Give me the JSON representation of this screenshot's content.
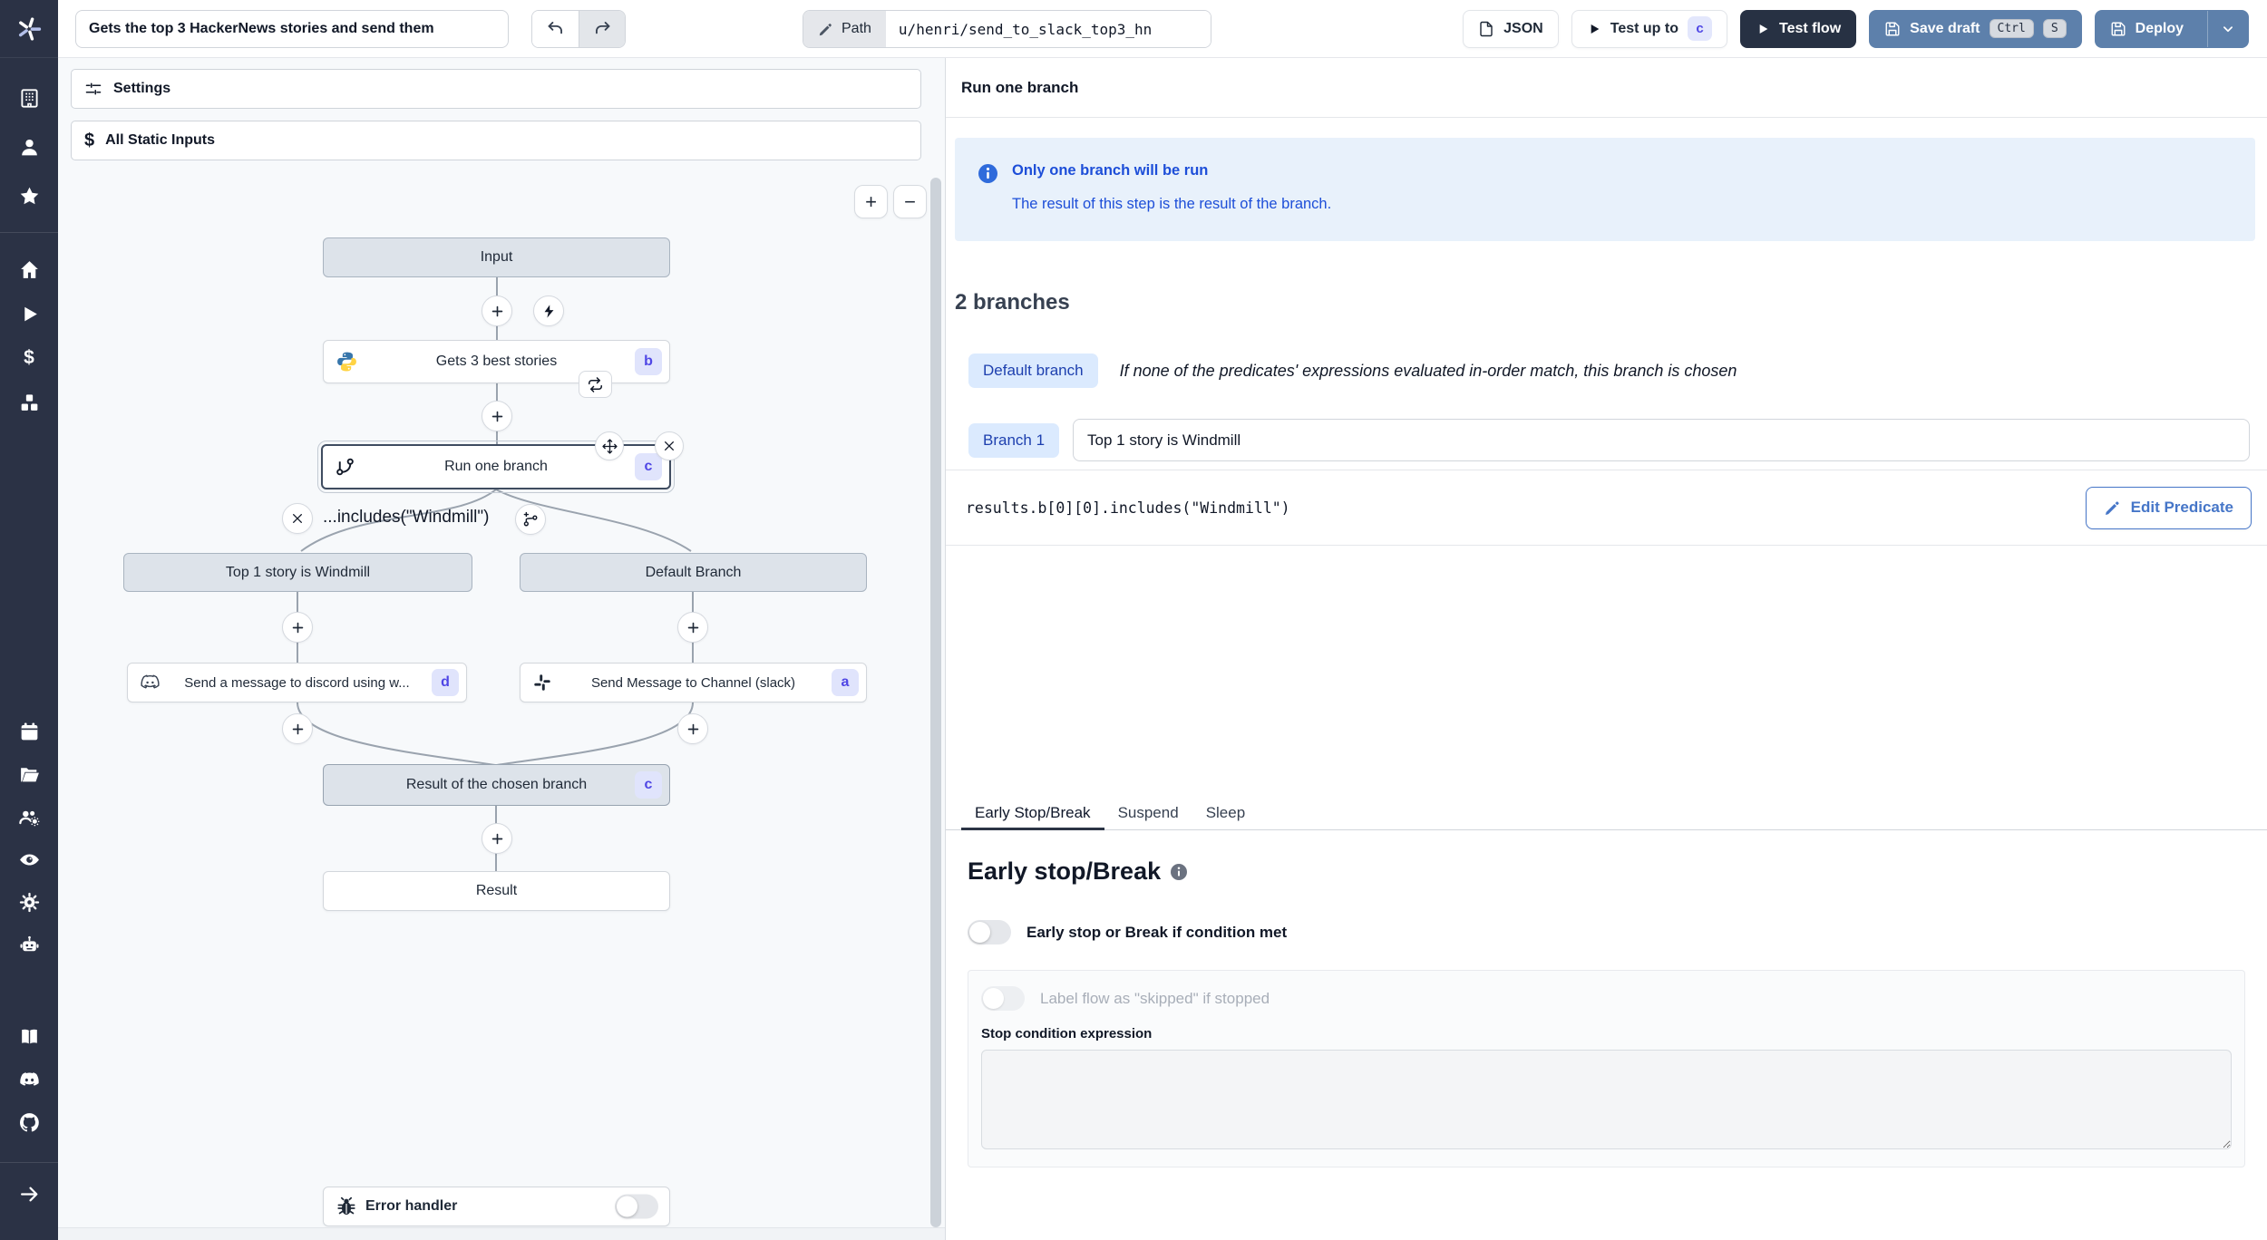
{
  "topbar": {
    "title_value": "Gets the top 3 HackerNews stories and send them",
    "path_label": "Path",
    "path_value": "u/henri/send_to_slack_top3_hn",
    "json_label": "JSON",
    "test_up_to_label": "Test up to",
    "test_up_to_badge": "c",
    "test_flow_label": "Test flow",
    "save_draft_label": "Save draft",
    "kbd": [
      "Ctrl",
      "S"
    ],
    "deploy_label": "Deploy"
  },
  "sidebar": {
    "icons": [
      "workspace",
      "user",
      "favorites",
      "home",
      "runs",
      "variables",
      "resources",
      "schedules",
      "folders",
      "groups",
      "audit-logs",
      "settings",
      "workers",
      "docs",
      "discord",
      "github",
      "expand-sidebar"
    ]
  },
  "flow": {
    "settings_label": "Settings",
    "static_inputs_label": "All Static Inputs",
    "zoom_in": "+",
    "zoom_out": "−",
    "nodes": {
      "input_label": "Input",
      "step_b_label": "Gets 3 best stories",
      "step_b_badge": "b",
      "branch_step_label": "Run one branch",
      "branch_step_badge": "c",
      "predicate_preview": "...includes(\"Windmill\")",
      "branch_left_label": "Top 1 story is Windmill",
      "branch_right_label": "Default Branch",
      "step_d_label": "Send a message to discord using w...",
      "step_d_badge": "d",
      "step_a_label": "Send Message to Channel (slack)",
      "step_a_badge": "a",
      "result_branch_label": "Result of the chosen branch",
      "result_branch_badge": "c",
      "result_label": "Result",
      "error_handler_label": "Error handler"
    }
  },
  "detail": {
    "title": "Run one branch",
    "info_title": "Only one branch will be run",
    "info_body": "The result of this step is the result of the branch.",
    "branches_heading": "2 branches",
    "default_branch_badge": "Default branch",
    "default_branch_desc": "If none of the predicates' expressions evaluated in-order match, this branch is chosen",
    "branch1_badge": "Branch 1",
    "branch1_summary": "Top 1 story is Windmill",
    "branch1_predicate": "results.b[0][0].includes(\"Windmill\")",
    "edit_predicate_label": "Edit Predicate",
    "tabs": [
      "Early Stop/Break",
      "Suspend",
      "Sleep"
    ],
    "early_stop_heading": "Early stop/Break",
    "early_stop_toggle_label": "Early stop or Break if condition met",
    "skip_toggle_label": "Label flow as \"skipped\" if stopped",
    "stop_condition_label": "Stop condition expression",
    "stop_condition_value": ""
  },
  "colors": {
    "rail_bg": "#2b3245",
    "primary_button": "#5d80ab",
    "dark_button": "#273143",
    "step_badge_bg": "#e0e4fc",
    "step_badge_text": "#4f46e5",
    "info_bg": "#e8f1fb",
    "info_text": "#1d4ed8",
    "branch_badge_bg": "#dbeafe",
    "branch_badge_text": "#1e40af",
    "node_gray": "#dde3ea",
    "canvas_bg": "#f7f9fb"
  }
}
